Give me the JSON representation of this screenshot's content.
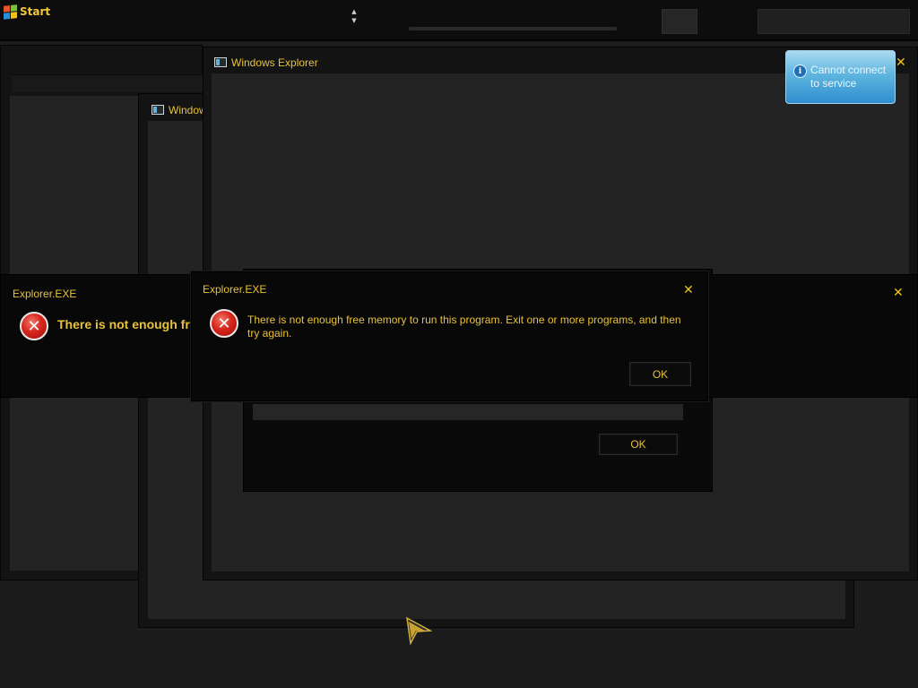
{
  "taskbar": {
    "start_label": "Start"
  },
  "windows": {
    "explorer_back_title": "Window",
    "explorer_main_title": "Windows Explorer"
  },
  "toast": {
    "message": "Cannot connect to service",
    "icon": "info-icon"
  },
  "dialog_left": {
    "title": "Explorer.EXE",
    "message": "There is not enough fre",
    "icon": "error-icon"
  },
  "dialog_main": {
    "title": "Explorer.EXE",
    "message": "There is not enough free memory to run this program. Exit one or more programs, and then try again.",
    "ok_label": "OK",
    "icon": "error-icon"
  },
  "dialog_hidden": {
    "ok_label": "OK"
  },
  "colors": {
    "accent_text": "#e8c238",
    "error_red": "#d7261c",
    "toast_blue": "#5fb5df"
  }
}
